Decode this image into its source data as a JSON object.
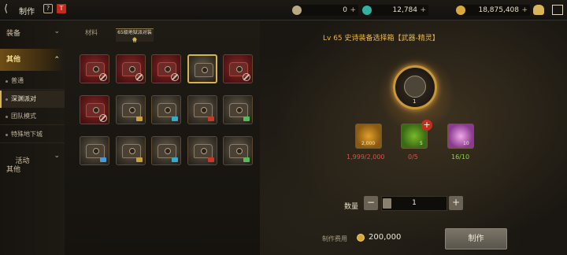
{
  "header": {
    "title": "制作",
    "help": "?",
    "flag": "T",
    "back_glyph": "⟨"
  },
  "currencies": [
    {
      "icon": "silver-c-icon",
      "value": "0",
      "color": "#b9a981"
    },
    {
      "icon": "green-gem-icon",
      "value": "12,784",
      "color": "#2fb3a0"
    },
    {
      "icon": "gold-coin-icon",
      "value": "18,875,408",
      "color": "#d8a83a"
    }
  ],
  "sidebar": {
    "categories": [
      {
        "label": "装备",
        "selected": false
      },
      {
        "label": "其他",
        "selected": true
      },
      {
        "label": "活动\n其他",
        "selected": false
      }
    ],
    "sub_items": [
      {
        "label": "普通",
        "selected": false
      },
      {
        "label": "深渊派对",
        "selected": true
      },
      {
        "label": "团队模式",
        "selected": false
      },
      {
        "label": "特殊地下城",
        "selected": false
      }
    ]
  },
  "tabs": {
    "materials": "材料",
    "selected": "65级地狱派对装备"
  },
  "grid": {
    "rows": [
      [
        "red",
        "red",
        "red",
        "sel",
        "red"
      ],
      [
        "red",
        "dark",
        "dark",
        "dark",
        "dark"
      ],
      [
        "dark",
        "dark",
        "dark",
        "dark",
        "dark"
      ]
    ],
    "banned": [
      [
        0,
        0
      ],
      [
        0,
        1
      ],
      [
        0,
        2
      ],
      [
        0,
        4
      ],
      [
        1,
        0
      ]
    ]
  },
  "detail": {
    "title": "Lv 65 史诗装备选择箱【武器-精灵】",
    "orb_count": "1",
    "materials": [
      {
        "count": "2,000",
        "label": "1,999/2,000",
        "label_color": "#d8534a"
      },
      {
        "count": "5",
        "label": "0/5",
        "label_color": "#d8534a"
      },
      {
        "count": "10",
        "label": "16/10",
        "label_color": "#8fd14a"
      }
    ],
    "add_glyph": "+"
  },
  "quantity": {
    "label": "数量",
    "minus": "−",
    "plus": "+",
    "value": "1"
  },
  "fee": {
    "label": "制作费用",
    "value": "200,000"
  },
  "make_button": "制作"
}
